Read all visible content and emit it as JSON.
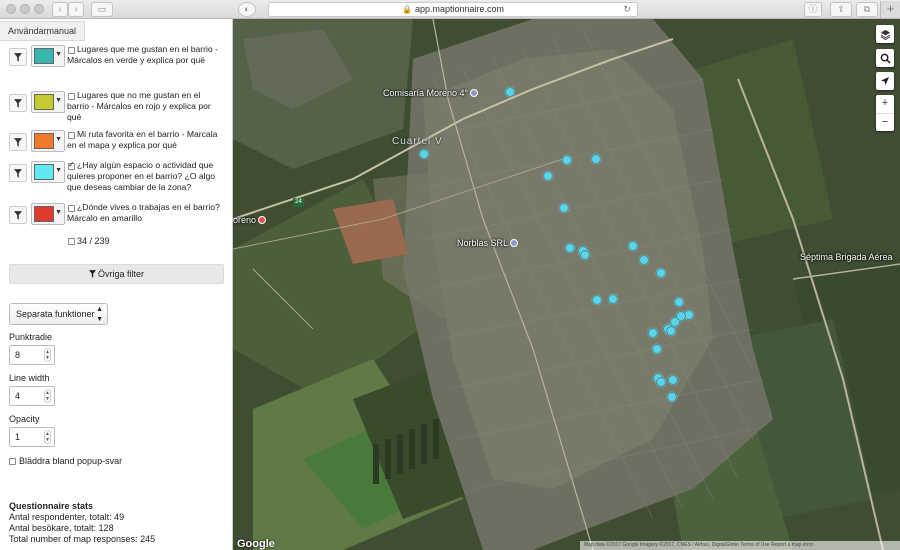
{
  "browser": {
    "url": "app.maptionnaire.com"
  },
  "sidebar": {
    "manual_tab": "Användarmanual",
    "filters": [
      {
        "color": "#37b5ae",
        "checked": false,
        "label": "Lugares que me gustan en el barrio - Márcalos en verde y explica por qué"
      },
      {
        "color": "#c4cc2f",
        "checked": false,
        "label": "Lugares que no me gustan en el barrio - Márcalos en rojo y explica por qué"
      },
      {
        "color": "#f07a2b",
        "checked": false,
        "label": "Mi ruta favorita en el barrio - Marcala en el mapa y explica por qué"
      },
      {
        "color": "#5fe8f2",
        "checked": true,
        "label": "¿Hay algún espacio o actividad que quieres proponer en el barrio? ¿O algo que deseas cambiar de la zona?"
      },
      {
        "color": "#e0392d",
        "checked": false,
        "label": "¿Dónde vives o trabajas en el barrio? Márcalo en amarillo"
      }
    ],
    "count": "34 / 239",
    "other_filters": "Övriga filter",
    "separate_functions": "Separata funktioner",
    "point_radius_label": "Punktradie",
    "point_radius": "8",
    "line_width_label": "Line width",
    "line_width": "4",
    "opacity_label": "Opacity",
    "opacity": "1",
    "popup_label": "Bläddra bland popup-svar",
    "stats": {
      "title": "Questionnaire stats",
      "respondents": "Antal respondenter, totalt: 49",
      "visitors": "Antal besökare, totalt: 128",
      "map_responses": "Total number of map responses: 245"
    }
  },
  "map": {
    "labels": {
      "comisaria": "Comisaría Moreno 4°",
      "cuartel": "Cuartel V",
      "moreno": "oreno",
      "norblas": "Norblas SRL",
      "septima": "Séptima Brigada Aérea"
    },
    "google": "Google",
    "attribution": "Map data ©2017 Google Imagery ©2017, CNES / Airbus, DigitalGlobe  Terms of Use  Report a map error",
    "marker_color": "#5fd3e6",
    "road_number": "24"
  }
}
